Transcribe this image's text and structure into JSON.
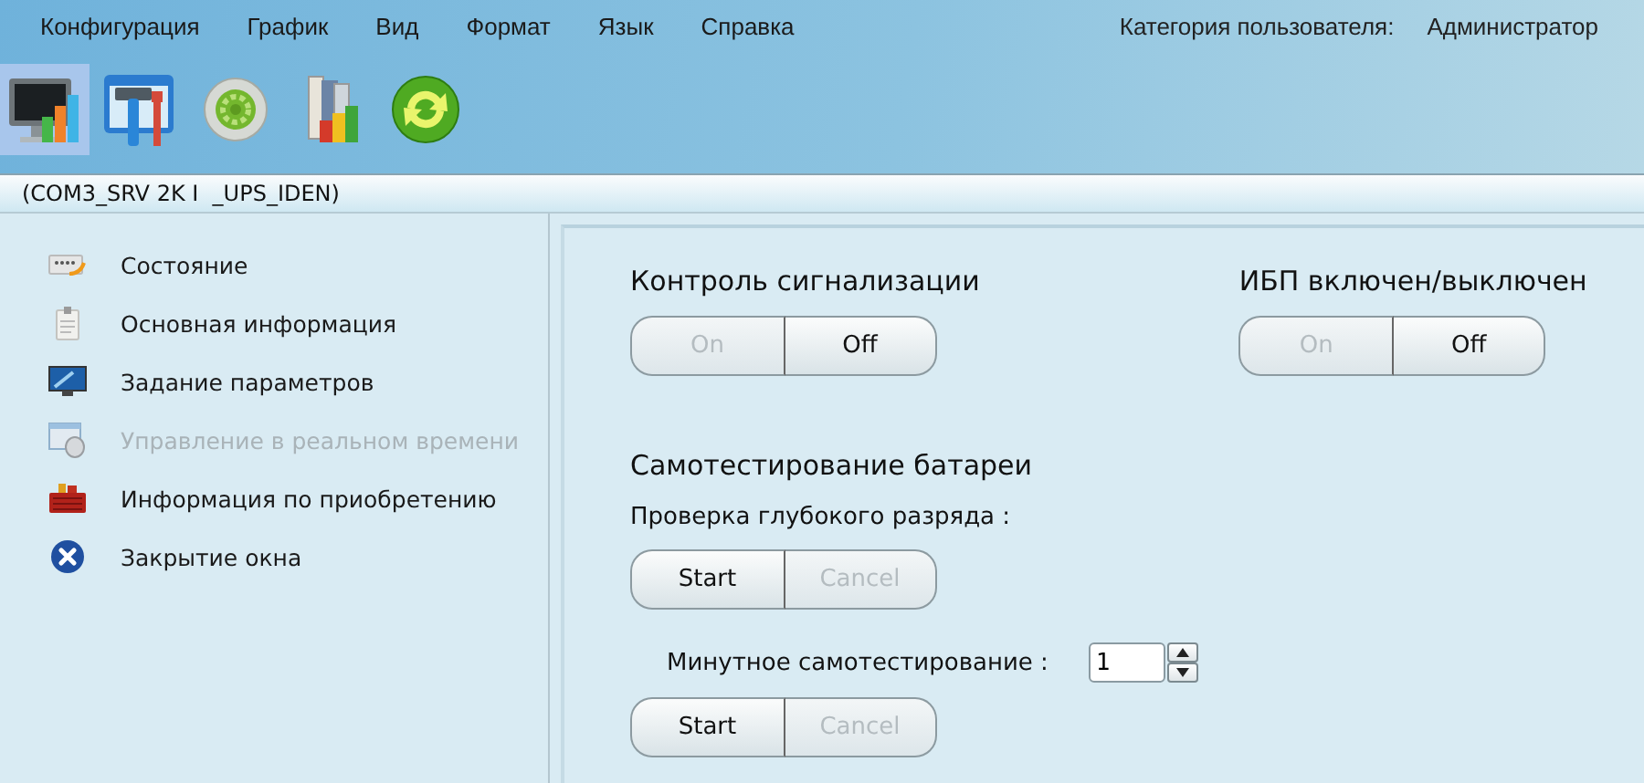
{
  "menu": [
    "Конфигурация",
    "График",
    "Вид",
    "Формат",
    "Язык",
    "Справка"
  ],
  "user": {
    "label": "Категория пользователя:",
    "value": "Администратор"
  },
  "toolbar": [
    {
      "kind": "monitor",
      "selected": true
    },
    {
      "kind": "tools",
      "selected": false
    },
    {
      "kind": "gear",
      "selected": false
    },
    {
      "kind": "books",
      "selected": false
    },
    {
      "kind": "refresh",
      "selected": false
    }
  ],
  "path": "(COM3_SRV 2K I  _UPS_IDEN)",
  "sidebar": {
    "items": [
      {
        "kind": "status",
        "label": "Состояние",
        "disabled": false
      },
      {
        "kind": "info",
        "label": "Основная информация",
        "disabled": false
      },
      {
        "kind": "settings",
        "label": "Задание параметров",
        "disabled": false
      },
      {
        "kind": "control",
        "label": "Управление в реальном времени",
        "disabled": true
      },
      {
        "kind": "purchase",
        "label": "Информация по приобретению",
        "disabled": false
      },
      {
        "kind": "close",
        "label": "Закрытие окна",
        "disabled": false
      }
    ]
  },
  "alarm": {
    "title": "Контроль сигнализации",
    "buttons": [
      {
        "label": "On",
        "disabled": true
      },
      {
        "label": "Off",
        "disabled": false
      }
    ]
  },
  "ups_power": {
    "title": "ИБП включен/выключен",
    "buttons": [
      {
        "label": "On",
        "disabled": true
      },
      {
        "label": "Off",
        "disabled": false
      }
    ]
  },
  "battery_test": {
    "title": "Самотестирование батареи",
    "deep_discharge": {
      "label": "Проверка глубокого разряда :",
      "buttons": [
        {
          "label": "Start",
          "disabled": false
        },
        {
          "label": "Cancel",
          "disabled": true
        }
      ]
    },
    "minute_test": {
      "label": "Минутное самотестирование :",
      "value": "1",
      "buttons": [
        {
          "label": "Start",
          "disabled": false
        },
        {
          "label": "Cancel",
          "disabled": true
        }
      ]
    }
  }
}
